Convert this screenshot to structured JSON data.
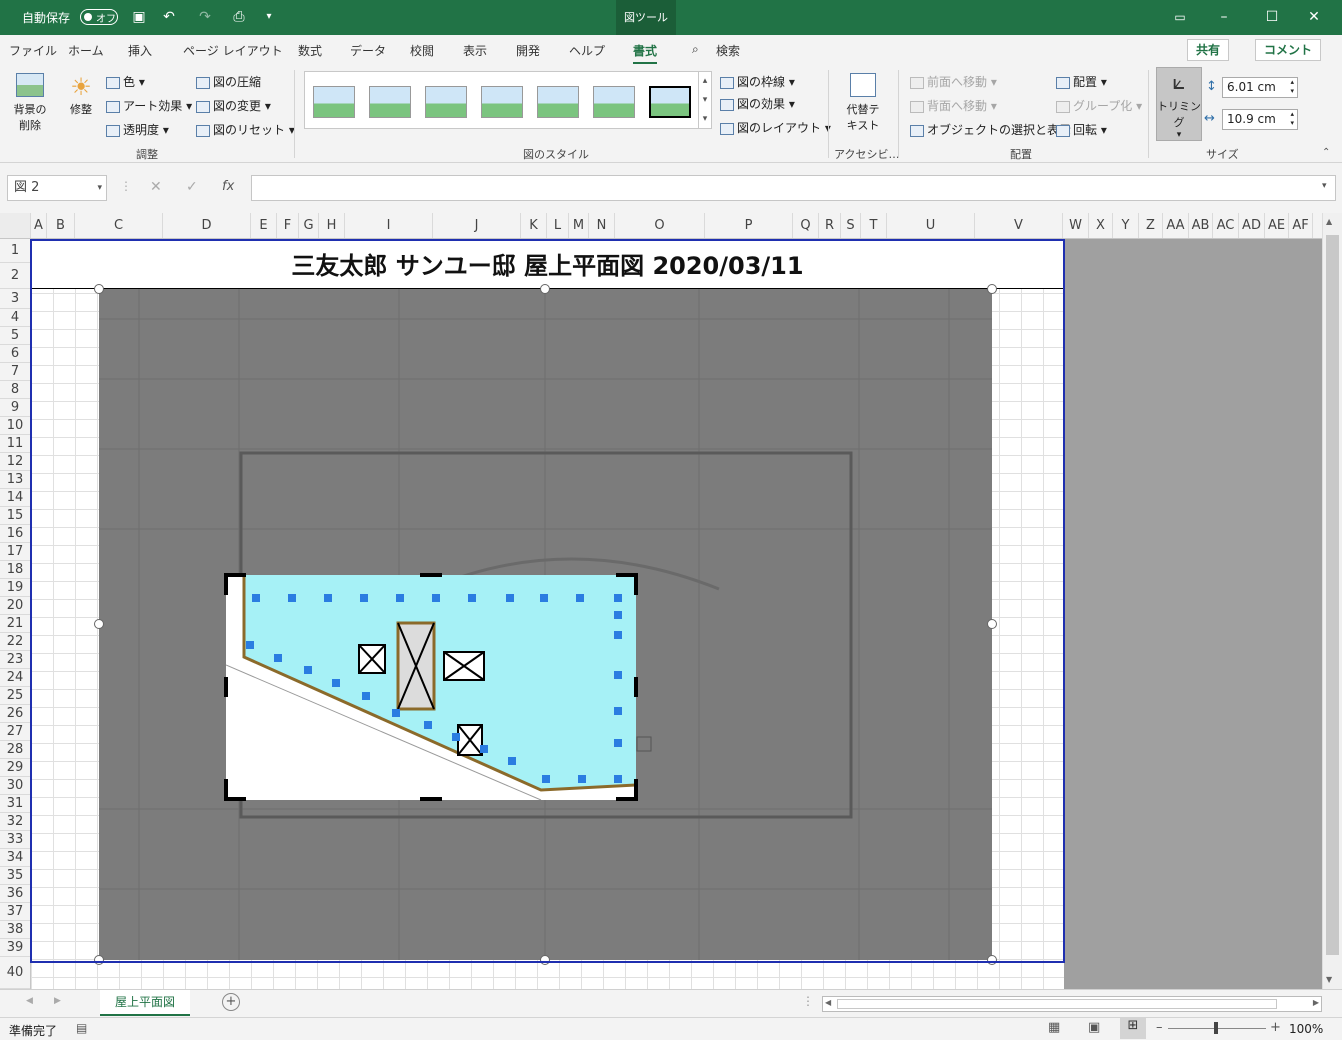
{
  "titlebar": {
    "autosave_label": "自動保存",
    "autosave_state": "オフ",
    "tool_context": "図ツール",
    "icons": [
      "save-icon",
      "undo-icon",
      "redo-icon",
      "touch-mode-icon",
      "customize-qat-icon"
    ]
  },
  "tabs": [
    {
      "label": "ファイル"
    },
    {
      "label": "ホーム"
    },
    {
      "label": "挿入"
    },
    {
      "label": "ページ レイアウト"
    },
    {
      "label": "数式"
    },
    {
      "label": "データ"
    },
    {
      "label": "校閲"
    },
    {
      "label": "表示"
    },
    {
      "label": "開発"
    },
    {
      "label": "ヘルプ"
    },
    {
      "label": "書式",
      "active": true
    }
  ],
  "search_label": "検索",
  "share_label": "共有",
  "comment_label": "コメント",
  "ribbon": {
    "remove_bg": "背景の\n削除",
    "corrections": "修整",
    "color": "色",
    "art_effects": "アート効果",
    "transparency": "透明度",
    "compress": "図の圧縮",
    "change_pic": "図の変更",
    "reset_pic": "図のリセット",
    "group_adjust": "調整",
    "group_styles": "図のスタイル",
    "border": "図の枠線",
    "effects": "図の効果",
    "layout": "図のレイアウト",
    "alt_text": "代替テ\nキスト",
    "group_access": "アクセシビ…",
    "bring_forward": "前面へ移動",
    "send_backward": "背面へ移動",
    "selection_pane": "オブジェクトの選択と表示",
    "align": "配置",
    "group": "グループ化",
    "rotate": "回転",
    "group_arrange": "配置",
    "crop": "トリミング",
    "height": "6.01 cm",
    "width": "10.9 cm",
    "group_size": "サイズ"
  },
  "namebox": "図 2",
  "formula_icons": [
    "cancel-icon",
    "enter-icon",
    "function-icon"
  ],
  "columns": [
    "A",
    "B",
    "C",
    "D",
    "E",
    "F",
    "G",
    "H",
    "I",
    "J",
    "K",
    "L",
    "M",
    "N",
    "O",
    "P",
    "Q",
    "R",
    "S",
    "T",
    "U",
    "V",
    "W",
    "X",
    "Y",
    "Z",
    "AA",
    "AB",
    "AC",
    "AD",
    "AE",
    "AF"
  ],
  "rows": [
    "1",
    "2",
    "3",
    "4",
    "5",
    "6",
    "7",
    "8",
    "9",
    "10",
    "11",
    "12",
    "13",
    "14",
    "15",
    "16",
    "17",
    "18",
    "19",
    "20",
    "21",
    "22",
    "23",
    "24",
    "25",
    "26",
    "27",
    "28",
    "29",
    "30",
    "31",
    "32",
    "33",
    "34",
    "35",
    "36",
    "37",
    "38",
    "39",
    "40"
  ],
  "sheet_title": "三友太郎 サンユー邸 屋上平面図  2020/03/11",
  "sheet_tab": "屋上平面図",
  "status_ready": "準備完了",
  "zoom": "100%"
}
